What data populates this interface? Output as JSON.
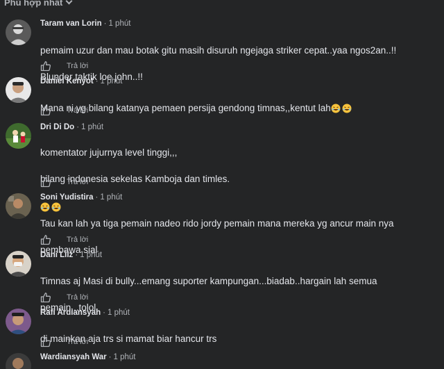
{
  "sort": {
    "label": "Phù hợp nhất"
  },
  "reply_label": "Trả lời",
  "comments": [
    {
      "name": "Taram van Lorin",
      "time": "1 phút",
      "lines": [
        "pemaim uzur dan mau botak gitu masih disuruh ngejaga striker cepat..yaa ngos2an..!!",
        "Blunder taktik loe john..!!"
      ]
    },
    {
      "name": "Daniel Kenyot",
      "time": "1 phút",
      "lines": [
        "Mana ni yg bilang katanya pemaen persija gendong timnas,,kentut lah"
      ]
    },
    {
      "name": "Dri Di Do",
      "time": "1 phút",
      "lines": [
        "komentator jujurnya level tinggi,,,",
        "bilang indonesia sekelas Kamboja dan timles."
      ]
    },
    {
      "name": "Soni Yudistira",
      "time": "1 phút",
      "lines": [
        "Tau kan lah ya tiga pemain nadeo rido jordy pemain mana mereka yg ancur main nya",
        "pembawa sial"
      ]
    },
    {
      "name": "Dani Liiz",
      "time": "1 phút",
      "lines": [
        "Timnas aj Masi di bully...emang suporter kampungan...biadab..hargain lah semua",
        "pemain...tolol"
      ]
    },
    {
      "name": "Rafi Ardiansyah",
      "time": "1 phút",
      "lines": [
        "di mainkan aja trs si mamat biar hancur trs"
      ]
    },
    {
      "name": "Wardiansyah War",
      "time": "1 phút",
      "lines": []
    }
  ]
}
